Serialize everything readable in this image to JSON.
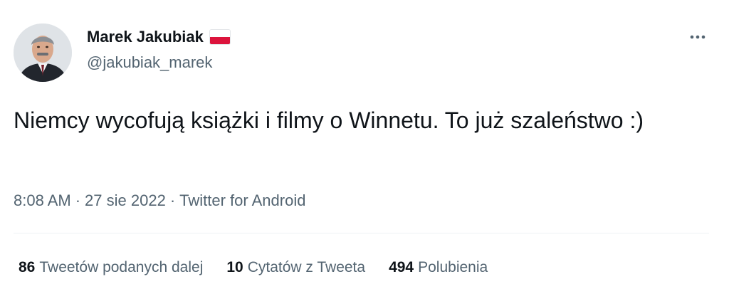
{
  "user": {
    "display_name": "Marek Jakubiak",
    "handle": "@jakubiak_marek",
    "flag_icon": "poland-flag-icon"
  },
  "tweet": {
    "text": "Niemcy wycofują książki i filmy o Winnetu. To już szaleństwo :)",
    "time": "8:08 AM",
    "date": "27 sie 2022",
    "source": "Twitter for Android",
    "separator": "·"
  },
  "stats": [
    {
      "count": "86",
      "label": "Tweetów podanych dalej"
    },
    {
      "count": "10",
      "label": "Cytatów z Tweeta"
    },
    {
      "count": "494",
      "label": "Polubienia"
    }
  ],
  "colors": {
    "text_primary": "#0f1419",
    "text_secondary": "#536471",
    "divider": "#eff3f4",
    "flag_red": "#dc143c"
  }
}
